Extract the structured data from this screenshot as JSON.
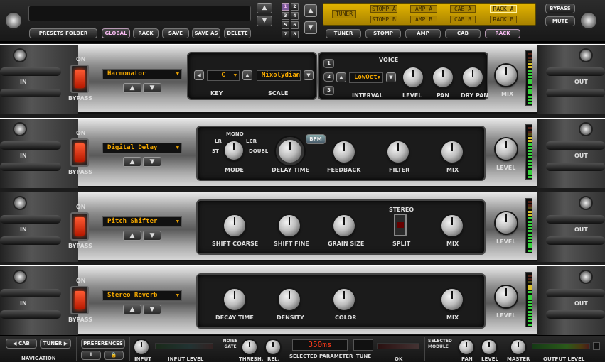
{
  "top": {
    "presets_folder": "PRESETS FOLDER",
    "global": "GLOBAL",
    "rack": "RACK",
    "save": "SAVE",
    "save_as": "SAVE AS",
    "delete": "DELETE",
    "bank_numbers": [
      "1",
      "2",
      "3",
      "4",
      "5",
      "6",
      "7",
      "8"
    ],
    "chain": {
      "tuner": "TUNER",
      "stomp_a": "STOMP A",
      "stomp_b": "STOMP B",
      "amp_a": "AMP A",
      "amp_b": "AMP B",
      "cab_a": "CAB A",
      "cab_b": "CAB B",
      "rack_a": "RACK A",
      "rack_b": "RACK B"
    },
    "tabs": [
      "TUNER",
      "STOMP",
      "AMP",
      "CAB",
      "RACK"
    ],
    "bypass": "BYPASS",
    "mute": "MUTE"
  },
  "racks": [
    {
      "on": "ON",
      "bypass": "BYPASS",
      "name": "Harmonator",
      "key_value": "C",
      "scale_value": "Mixolydian",
      "key_label": "KEY",
      "scale_label": "SCALE",
      "voice_label": "VOICE",
      "voices": [
        "1",
        "2",
        "3"
      ],
      "interval_value": "LowOct",
      "interval_label": "INTERVAL",
      "level": "LEVEL",
      "pan": "PAN",
      "dry_pan": "DRY PAN",
      "mix": "MIX"
    },
    {
      "on": "ON",
      "bypass": "BYPASS",
      "name": "Digital Delay",
      "mode_options": [
        "MONO",
        "LR",
        "LCR",
        "ST",
        "DOUBL"
      ],
      "mode": "MODE",
      "delay_time": "DELAY TIME",
      "bpm": "BPM",
      "feedback": "FEEDBACK",
      "filter": "FILTER",
      "mix": "MIX",
      "level": "LEVEL"
    },
    {
      "on": "ON",
      "bypass": "BYPASS",
      "name": "Pitch Shifter",
      "shift_coarse": "SHIFT COARSE",
      "shift_fine": "SHIFT FINE",
      "grain_size": "GRAIN SIZE",
      "stereo": "STEREO",
      "split": "SPLIT",
      "mix": "MIX",
      "level": "LEVEL"
    },
    {
      "on": "ON",
      "bypass": "BYPASS",
      "name": "Stereo Reverb",
      "decay_time": "DECAY TIME",
      "density": "DENSITY",
      "color": "COLOR",
      "mix": "MIX",
      "level": "LEVEL"
    }
  ],
  "io": {
    "in": "IN",
    "out": "OUT"
  },
  "bottom": {
    "cab": "CAB",
    "tuner": "TUNER",
    "navigation": "NAVIGATION",
    "preferences": "PREFERENCES",
    "input": "INPUT",
    "input_level": "INPUT LEVEL",
    "noise_gate": "NOISE GATE",
    "thresh": "THRESH.",
    "rel": "REL.",
    "selected_value": "350ms",
    "selected_parameter": "SELECTED PARAMETER",
    "tune": "TUNE",
    "ok": "OK",
    "selected_module": "SELECTED MODULE",
    "pan": "PAN",
    "level": "LEVEL",
    "master": "MASTER",
    "output_level": "OUTPUT LEVEL"
  },
  "colors": {
    "accent": "#f4a800",
    "led_red": "#ff3a1a",
    "meter_green": "#37d23d"
  }
}
